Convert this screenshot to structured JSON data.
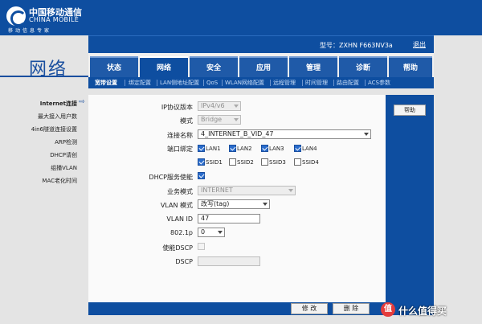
{
  "brand": {
    "name_cn": "中国移动通信",
    "name_en": "CHINA MOBILE",
    "slogan": "移动信息专家"
  },
  "header": {
    "model_label": "型号：ZXHN F663NV3a",
    "logout_label": "退出"
  },
  "section_title": "网络",
  "main_tabs": [
    {
      "label": "状态",
      "active": false
    },
    {
      "label": "网络",
      "active": true
    },
    {
      "label": "安全",
      "active": false
    },
    {
      "label": "应用",
      "active": false
    },
    {
      "label": "管理",
      "active": false
    },
    {
      "label": "诊断",
      "active": false
    },
    {
      "label": "帮助",
      "active": false
    }
  ],
  "sub_tabs": [
    {
      "label": "宽带设置",
      "active": true
    },
    {
      "label": "绑定配置",
      "active": false
    },
    {
      "label": "LAN侧地址配置",
      "active": false
    },
    {
      "label": "QoS",
      "active": false
    },
    {
      "label": "WLAN网络配置",
      "active": false
    },
    {
      "label": "远程管理",
      "active": false
    },
    {
      "label": "时间管理",
      "active": false
    },
    {
      "label": "路由配置",
      "active": false
    },
    {
      "label": "ACS参数",
      "active": false
    }
  ],
  "left_nav": [
    {
      "label": "Internet连接",
      "active": true
    },
    {
      "label": "最大接入用户数",
      "active": false
    },
    {
      "label": "4in6隧道连接设置",
      "active": false
    },
    {
      "label": "ARP检测",
      "active": false
    },
    {
      "label": "DHCP请创",
      "active": false
    },
    {
      "label": "组播VLAN",
      "active": false
    },
    {
      "label": "MAC老化时间",
      "active": false
    }
  ],
  "form": {
    "ip_version": {
      "label": "IP协议版本",
      "value": "IPv4/v6"
    },
    "mode": {
      "label": "模式",
      "value": "Bridge"
    },
    "connection_name": {
      "label": "连接名称",
      "value": "4_INTERNET_B_VID_47"
    },
    "port_binding": {
      "label": "端口绑定",
      "ports": [
        {
          "label": "LAN1",
          "checked": true
        },
        {
          "label": "LAN2",
          "checked": true
        },
        {
          "label": "LAN3",
          "checked": true
        },
        {
          "label": "LAN4",
          "checked": true
        },
        {
          "label": "SSID1",
          "checked": true
        },
        {
          "label": "SSID2",
          "checked": false
        },
        {
          "label": "SSID3",
          "checked": false
        },
        {
          "label": "SSID4",
          "checked": false
        }
      ]
    },
    "dhcp_service": {
      "label": "DHCP服务使能",
      "checked": true
    },
    "service_mode": {
      "label": "业务模式",
      "value": "INTERNET"
    },
    "vlan_mode": {
      "label": "VLAN 模式",
      "value": "改写(tag)"
    },
    "vlan_id": {
      "label": "VLAN ID",
      "value": "47"
    },
    "p8021": {
      "label": "802.1p",
      "value": "0"
    },
    "enable_dscp": {
      "label": "使能DSCP",
      "checked": false
    },
    "dscp": {
      "label": "DSCP",
      "value": ""
    }
  },
  "right_panel": {
    "help_label": "帮助"
  },
  "actions": {
    "modify_label": "修 改",
    "delete_label": "删 除"
  },
  "watermark": {
    "badge": "值",
    "text": "什么值得买"
  },
  "colors": {
    "primary_blue": "#0e4ea0",
    "tab_blue": "#1f5aa8",
    "background": "#e4e4e4",
    "checkbox_blue": "#2a6ccc"
  }
}
